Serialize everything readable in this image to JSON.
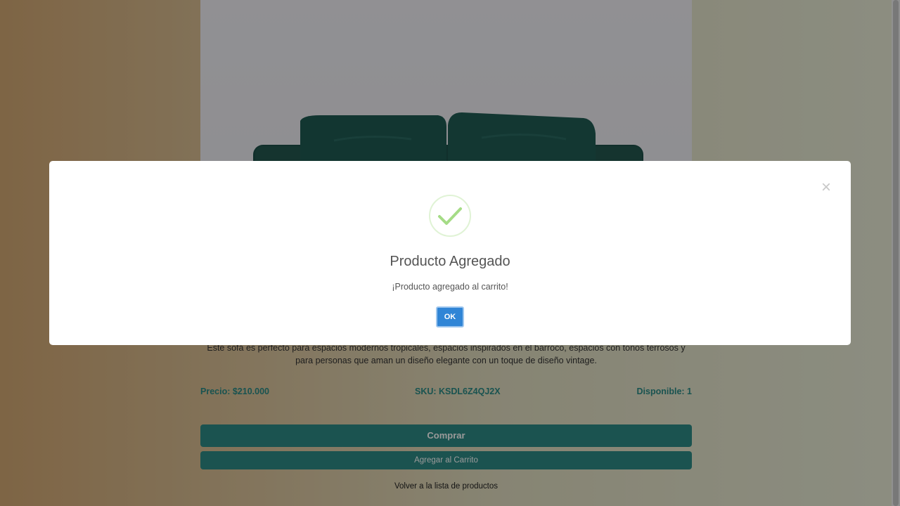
{
  "product": {
    "description": "Este sofá es perfecto para espacios modernos tropicales, espacios inspirados en el barroco, espacios con tonos terrosos y para personas que aman un diseño elegante con un toque de diseño vintage.",
    "price": "Precio: $210.000",
    "sku": "SKU: KSDL6Z4QJ2X",
    "available": "Disponible: 1",
    "sofa_color": "#1f5a52"
  },
  "actions": {
    "buy_label": "Comprar",
    "add_to_cart_label": "Agregar al Carrito",
    "back_label": "Volver a la lista de productos"
  },
  "modal": {
    "title": "Producto Agregado",
    "message": "¡Producto agregado al carrito!",
    "ok_label": "OK",
    "close_symbol": "×",
    "icon": "success-check-icon"
  },
  "colors": {
    "accent": "#2e8b85",
    "confirm_button": "#3085d6",
    "success": "#a5dc86"
  }
}
